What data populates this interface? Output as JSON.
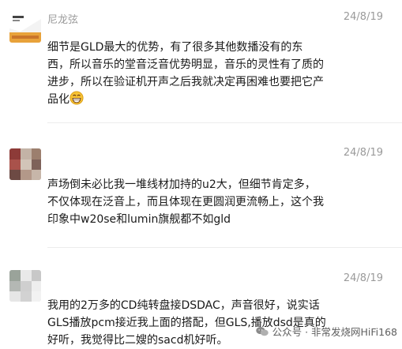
{
  "comments": [
    {
      "name": "尼龙弦",
      "date": "24/8/19",
      "lines": [
        "细节是GLD最大的优势，有了很多其他数播没有的东",
        "西，所以音乐的堂音泛音优势明显，音乐的灵性有了质的",
        "进步，所以在验证机开声之后我就决定再困难也要把它产",
        "品化"
      ],
      "emoji": "grinning-face"
    },
    {
      "name": "",
      "date": "24/8/19",
      "lines": [
        "声场倒未必比我一堆线材加持的u2大，但细节肯定多，",
        "不仅体现在泛音上，而且体现在更圆润更流畅上，这个我",
        "印象中w20se和lumin旗舰都不如gld"
      ]
    },
    {
      "name": "",
      "date": "24/8/19",
      "lines": [
        "我用的2万多的CD纯转盘接DSDAC，声音很好，说实话",
        "GLS播放pcm接近我上面的搭配，但GLS,播放dsd是真的",
        "好听，我觉得比二嫂的sacd机好听。"
      ]
    }
  ],
  "watermark": "公众号 · 非常发烧网HiFi168",
  "watermark_icon": "wechat-icon"
}
